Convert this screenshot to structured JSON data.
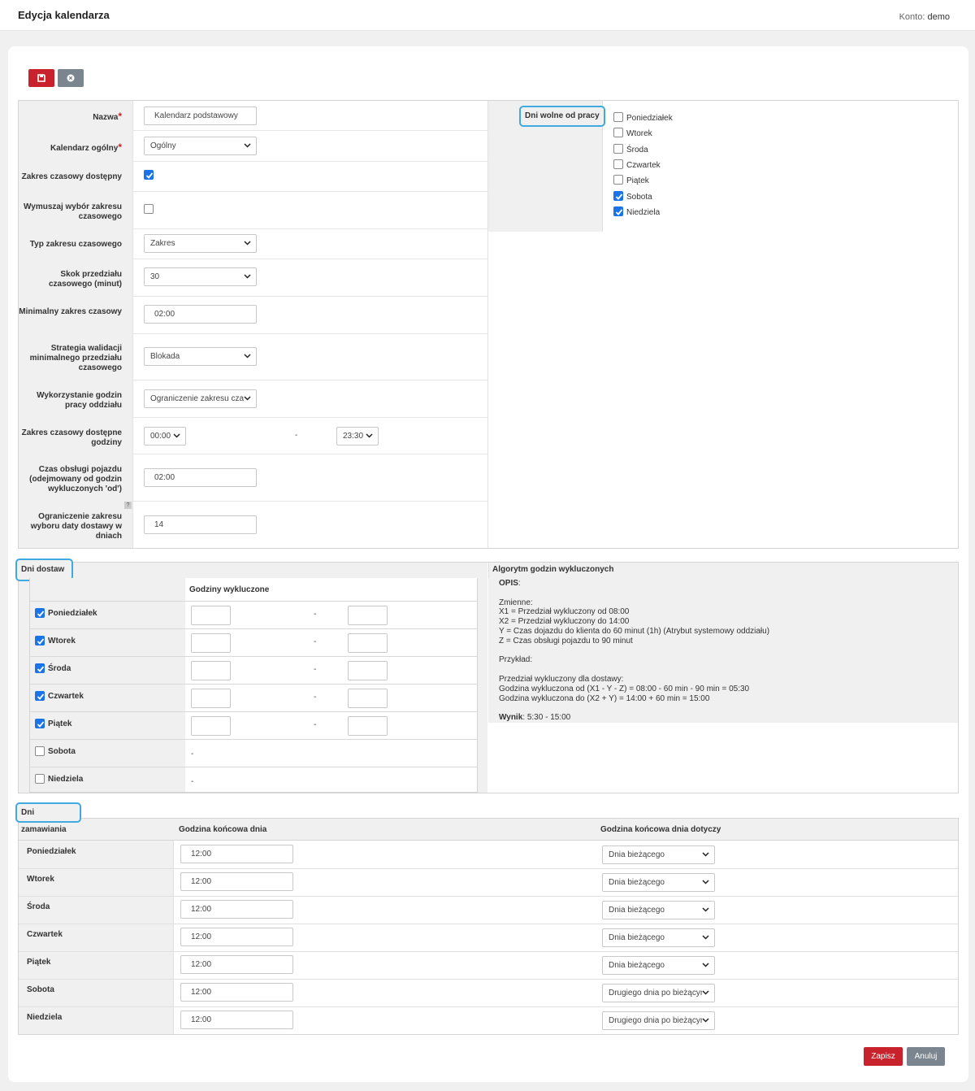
{
  "header": {
    "title": "Edycja kalendarza",
    "account_label": "Konto:",
    "account_name": "demo"
  },
  "form": {
    "nazwa_label": "Nazwa",
    "nazwa_value": "Kalendarz podstawowy",
    "kal_ogolny_label": "Kalendarz ogólny",
    "kal_ogolny_value": "Ogólny",
    "zakres_dostepny_label": "Zakres czasowy dostępny",
    "zakres_dostepny_checked": true,
    "wymuszaj_label": "Wymuszaj wybór zakresu czasowego",
    "wymuszaj_checked": false,
    "typ_label": "Typ zakresu czasowego",
    "typ_value": "Zakres",
    "skok_label": "Skok przedziału czasowego (minut)",
    "skok_value": "30",
    "min_label": "Minimalny zakres czasowy",
    "min_value": "02:00",
    "strategia_label": "Strategia walidacji minimalnego przedziału czasowego",
    "strategia_value": "Blokada",
    "wykorzystanie_label": "Wykorzystanie godzin pracy oddziału",
    "wykorzystanie_value": "Ograniczenie zakresu czasu",
    "godziny_label": "Zakres czasowy dostępne godziny",
    "godziny_from": "00:00",
    "godziny_sep": "-",
    "godziny_to": "23:30",
    "czas_label": "Czas obsługi pojazdu (odejmowany od godzin wykluczonych 'od')",
    "czas_value": "02:00",
    "help_mark": "?",
    "ogr_label": "Ograniczenie zakresu wyboru daty dostawy w dniach",
    "ogr_value": "14"
  },
  "dni_wolne": {
    "title": "Dni wolne od pracy",
    "days": [
      {
        "label": "Poniedziałek",
        "checked": false
      },
      {
        "label": "Wtorek",
        "checked": false
      },
      {
        "label": "Środa",
        "checked": false
      },
      {
        "label": "Czwartek",
        "checked": false
      },
      {
        "label": "Piątek",
        "checked": false
      },
      {
        "label": "Sobota",
        "checked": true
      },
      {
        "label": "Niedziela",
        "checked": true
      }
    ]
  },
  "dni_dostaw": {
    "title": "Dni dostaw",
    "col_header": "Godziny wykluczone",
    "rows": [
      {
        "label": "Poniedziałek",
        "checked": true,
        "sep": "-"
      },
      {
        "label": "Wtorek",
        "checked": true,
        "sep": "-"
      },
      {
        "label": "Środa",
        "checked": true,
        "sep": "-"
      },
      {
        "label": "Czwartek",
        "checked": true,
        "sep": "-"
      },
      {
        "label": "Piątek",
        "checked": true,
        "sep": "-"
      },
      {
        "label": "Sobota",
        "checked": false,
        "sep": "-"
      },
      {
        "label": "Niedziela",
        "checked": false,
        "sep": "-"
      }
    ]
  },
  "algorytm": {
    "title": "Algorytm godzin wykluczonych",
    "opis": "OPIS",
    "opis_colon": ":",
    "zmienne": "Zmienne:",
    "x1": "X1 = Przedział wykluczony od 08:00",
    "x2": "X2 = Przedział wykluczony do 14:00",
    "y": "Y = Czas dojazdu do klienta do 60 minut (1h) (Atrybut systemowy oddziału)",
    "z": "Z = Czas obsługi pojazdu to 90 minut",
    "przyklad": "Przykład:",
    "przedzial": "Przedział wykluczony dla dostawy:",
    "od": "Godzina wykluczona od (X1 - Y - Z) = 08:00 - 60 min - 90 min = 05:30",
    "do": "Godzina wykluczona do (X2 + Y) = 14:00 + 60 min = 15:00",
    "wynik_label": "Wynik",
    "wynik_value": ": 5:30 - 15:00"
  },
  "dni_zamawiania": {
    "title": "Dni zamawiania",
    "col1": "Godzina końcowa dnia",
    "col2": "Godzina końcowa dnia dotyczy",
    "rows": [
      {
        "label": "Poniedziałek",
        "time": "12:00",
        "dotyczy": "Dnia bieżącego"
      },
      {
        "label": "Wtorek",
        "time": "12:00",
        "dotyczy": "Dnia bieżącego"
      },
      {
        "label": "Środa",
        "time": "12:00",
        "dotyczy": "Dnia bieżącego"
      },
      {
        "label": "Czwartek",
        "time": "12:00",
        "dotyczy": "Dnia bieżącego"
      },
      {
        "label": "Piątek",
        "time": "12:00",
        "dotyczy": "Dnia bieżącego"
      },
      {
        "label": "Sobota",
        "time": "12:00",
        "dotyczy": "Drugiego dnia po bieżącym"
      },
      {
        "label": "Niedziela",
        "time": "12:00",
        "dotyczy": "Drugiego dnia po bieżącym"
      }
    ]
  },
  "footer": {
    "save_label": "Zapisz",
    "cancel_label": "Anuluj"
  },
  "colors": {
    "accent": "#1a73e8",
    "danger": "#c8232c",
    "highlight": "#3fa9e0",
    "secondary": "#7a8590"
  },
  "icons": {
    "save": "floppy-icon",
    "cancel": "cancel-circle-icon",
    "dropdown": "chevron-down-icon",
    "check": "check-icon"
  }
}
